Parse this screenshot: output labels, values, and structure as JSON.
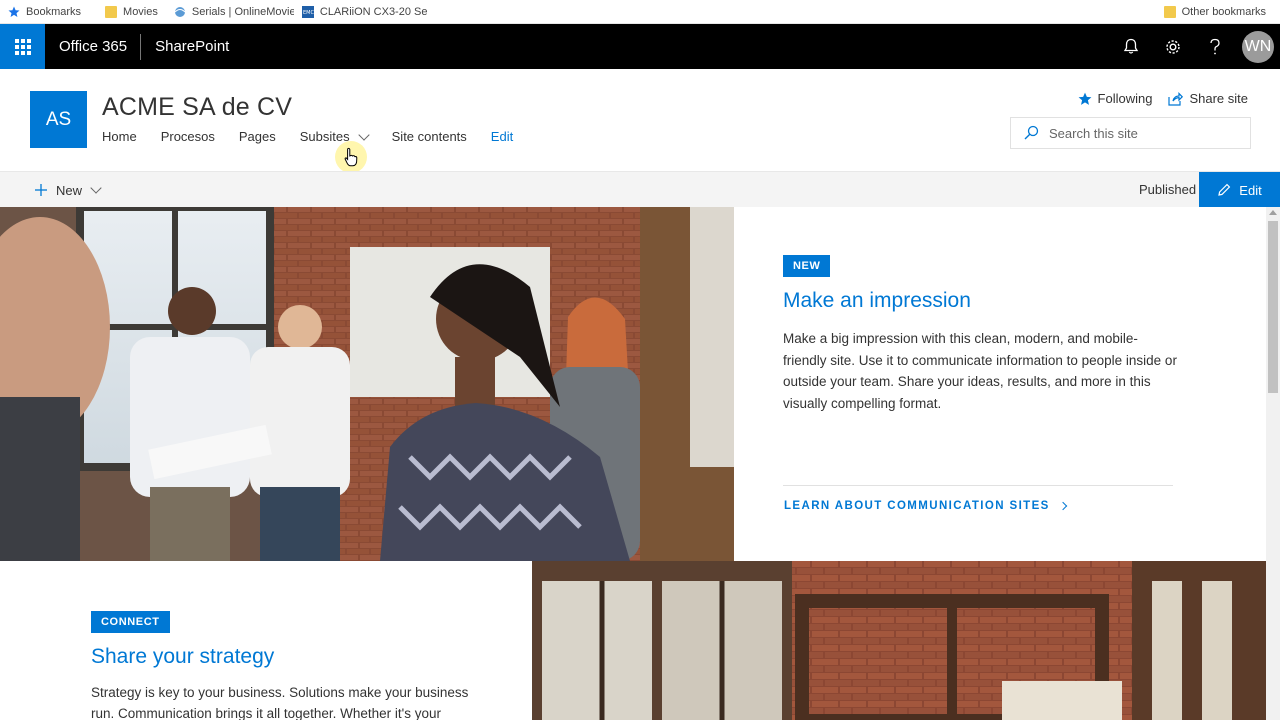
{
  "bookmarks_bar": {
    "items": [
      {
        "label": "Bookmarks",
        "icon": "star-icon"
      },
      {
        "label": "Movies",
        "icon": "folder-icon"
      },
      {
        "label": "Serials | OnlineMovie",
        "icon": "site-favicon"
      },
      {
        "label": "CLARiiON CX3-20 Se",
        "icon": "emc-favicon"
      }
    ],
    "other": "Other bookmarks"
  },
  "suite_bar": {
    "brand": "Office 365",
    "app": "SharePoint",
    "avatar_initials": "WN",
    "accent": "#0078d4"
  },
  "site_header": {
    "logo_initials": "AS",
    "title": "ACME SA de CV",
    "nav": [
      "Home",
      "Procesos",
      "Pages",
      "Subsites",
      "Site contents"
    ],
    "nav_edit": "Edit",
    "following": "Following",
    "share": "Share site",
    "search_placeholder": "Search this site"
  },
  "command_bar": {
    "new_label": "New",
    "status": "Published",
    "edit_label": "Edit"
  },
  "hero": {
    "badge": "NEW",
    "title": "Make an impression",
    "body": "Make a big impression with this clean, modern, and mobile-friendly site. Use it to communicate information to people inside or outside your team. Share your ideas, results, and more in this visually compelling format.",
    "link": "LEARN ABOUT COMMUNICATION SITES"
  },
  "section2": {
    "badge": "CONNECT",
    "title": "Share your strategy",
    "body": "Strategy is key to your business. Solutions make your business run. Communication brings it all together. Whether it's your"
  }
}
